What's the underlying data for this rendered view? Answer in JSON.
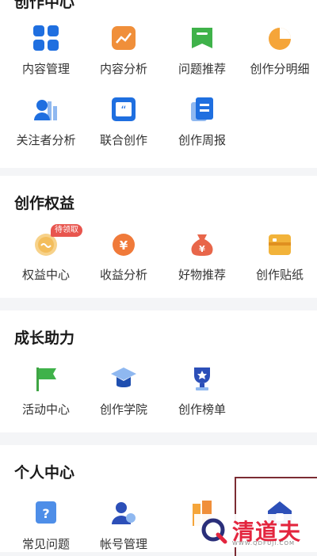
{
  "sections": [
    {
      "title": "创作中心",
      "items": [
        {
          "label": "内容管理",
          "icon": "grid-icon"
        },
        {
          "label": "内容分析",
          "icon": "trend-chart-icon"
        },
        {
          "label": "问题推荐",
          "icon": "question-bookmark-icon"
        },
        {
          "label": "创作分明细",
          "icon": "pie-chart-icon"
        },
        {
          "label": "关注者分析",
          "icon": "follower-chart-icon"
        },
        {
          "label": "联合创作",
          "icon": "quote-icon"
        },
        {
          "label": "创作周报",
          "icon": "report-icon"
        }
      ]
    },
    {
      "title": "创作权益",
      "items": [
        {
          "label": "权益中心",
          "icon": "coin-icon",
          "badge": "待领取"
        },
        {
          "label": "收益分析",
          "icon": "yen-coin-icon"
        },
        {
          "label": "好物推荐",
          "icon": "money-bag-icon"
        },
        {
          "label": "创作贴纸",
          "icon": "sticker-box-icon"
        }
      ]
    },
    {
      "title": "成长助力",
      "items": [
        {
          "label": "活动中心",
          "icon": "flag-icon"
        },
        {
          "label": "创作学院",
          "icon": "graduation-cap-icon"
        },
        {
          "label": "创作榜单",
          "icon": "trophy-icon"
        }
      ]
    },
    {
      "title": "个人中心",
      "items": [
        {
          "label": "常见问题",
          "icon": "help-icon"
        },
        {
          "label": "帐号管理",
          "icon": "account-icon"
        },
        {
          "label": "",
          "icon": "orange-book-icon"
        },
        {
          "label": "",
          "icon": "home-icon"
        }
      ]
    }
  ],
  "watermark": {
    "text": "清道夫",
    "url": "WWW.QDFUJI.COM"
  },
  "colors": {
    "blue": "#1f6fe0",
    "orange": "#f08f3a",
    "green": "#3fb24a",
    "red": "#e8554e"
  }
}
